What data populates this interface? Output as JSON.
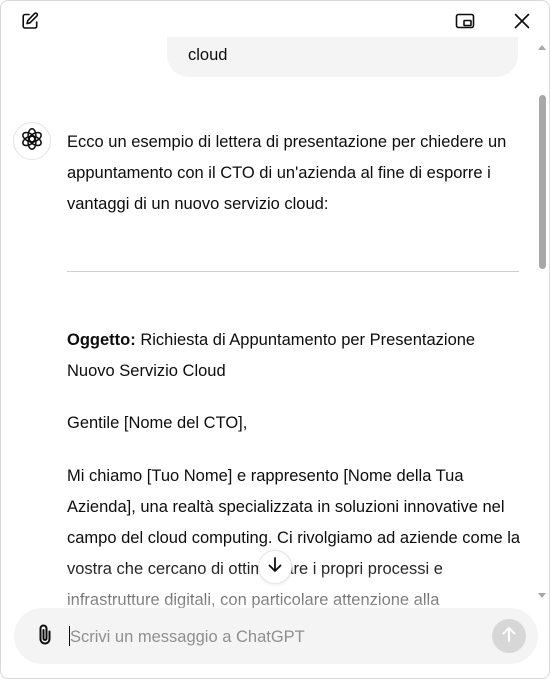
{
  "toolbar": {
    "icons": [
      "new-chat-icon",
      "picture-in-picture-icon",
      "close-icon"
    ]
  },
  "user_message": {
    "tail_text": "cloud"
  },
  "assistant": {
    "avatar_icon": "chatgpt-logo-icon",
    "intro": "Ecco un esempio di lettera di presentazione per chiedere un appuntamento con il CTO di un'azienda al fine di esporre i vantaggi di un nuovo servizio cloud:",
    "subject_label": "Oggetto:",
    "subject_text": " Richiesta di Appuntamento per Presentazione Nuovo Servizio Cloud",
    "greeting": "Gentile [Nome del CTO],",
    "body": "Mi chiamo [Tuo Nome] e rappresento [Nome della Tua Azienda], una realtà specializzata in soluzioni innovative nel campo del cloud computing. Ci rivolgiamo ad aziende come la vostra che cercano di ottimizzare i propri processi e infrastrutture digitali, con particolare attenzione alla"
  },
  "scroll_down_icon": "arrow-down-icon",
  "composer": {
    "placeholder": "Scrivi un messaggio a ChatGPT",
    "value": "",
    "attach_icon": "paperclip-icon",
    "send_icon": "arrow-up-icon"
  },
  "colors": {
    "background": "#ffffff",
    "bubble": "#f4f4f4",
    "text": "#0d0d0d",
    "placeholder": "#8f8f8f",
    "send_disabled": "#d7d7d7",
    "scrollbar": "#a8a8a8"
  }
}
